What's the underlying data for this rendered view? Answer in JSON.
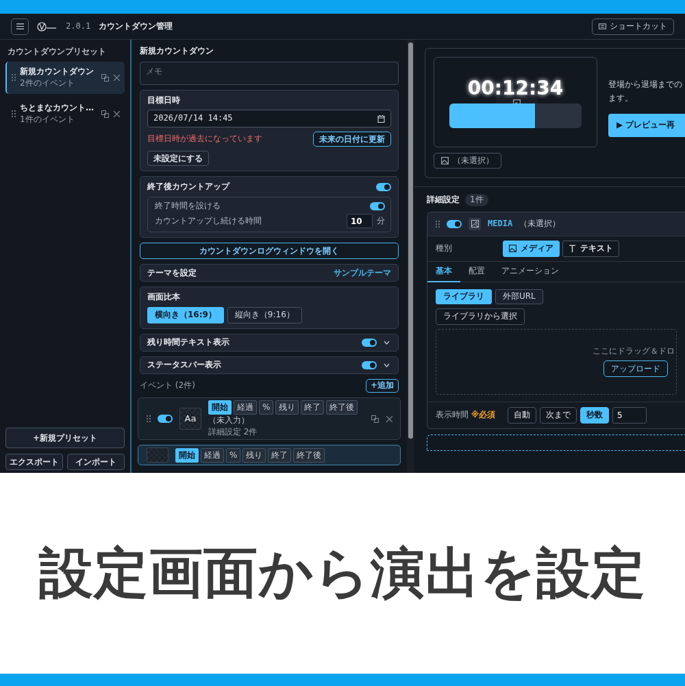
{
  "header": {
    "version": "2.0.1",
    "title": "カウントダウン管理",
    "shortcut_button": "ショートカット"
  },
  "sidebar": {
    "title": "カウントダウンプリセット",
    "presets": [
      {
        "name": "新規カウントダウン",
        "count": "2件のイベント",
        "selected": true
      },
      {
        "name": "ちとまなカウント…",
        "count": "1件のイベント",
        "selected": false
      }
    ],
    "new_preset_button": "+新規プリセット",
    "export_button": "エクスポート",
    "import_button": "インポート"
  },
  "editor": {
    "title": "新規カウントダウン",
    "memo": {
      "placeholder": "メモ"
    },
    "target": {
      "label": "目標日時",
      "value": "2026/07/14 14:45",
      "warning": "目標日時が過去になっています",
      "update_button": "未来の日付に更新",
      "clear_button": "未設定にする"
    },
    "countup": {
      "label": "終了後カウントアップ",
      "on": true,
      "end_time": {
        "label": "終了時間を設ける",
        "on": true
      },
      "duration": {
        "label": "カウントアップし続ける時間",
        "value": "10",
        "unit": "分"
      }
    },
    "log_button": "カウントダウンログウィンドウを開く",
    "theme": {
      "label": "テーマを設定",
      "value": "サンプルテーマ"
    },
    "aspect": {
      "label": "画面比本",
      "options": [
        {
          "label": "横向き（16:9）",
          "selected": true
        },
        {
          "label": "縦向き（9:16）",
          "selected": false
        }
      ]
    },
    "toggles": [
      {
        "label": "残り時間テキスト表示",
        "on": true
      },
      {
        "label": "ステータスバー表示",
        "on": true
      }
    ],
    "events": {
      "label": "イベント (2件)",
      "add_button": "+追加",
      "items": [
        {
          "selected": false,
          "on": true,
          "thumb": "Aa",
          "phases": [
            {
              "label": "開始",
              "selected": true
            },
            {
              "label": "経過",
              "selected": false
            },
            {
              "label": "%",
              "selected": false
            },
            {
              "label": "残り",
              "selected": false
            },
            {
              "label": "終了",
              "selected": false
            },
            {
              "label": "終了後",
              "selected": false
            }
          ],
          "name": "（未入力）",
          "detail": "詳細設定 2件"
        },
        {
          "selected": true,
          "phases": [
            {
              "label": "開始",
              "selected": true
            },
            {
              "label": "経過",
              "selected": false
            },
            {
              "label": "%",
              "selected": false
            },
            {
              "label": "残り",
              "selected": false
            },
            {
              "label": "終了",
              "selected": false
            },
            {
              "label": "終了後",
              "selected": false
            }
          ]
        }
      ]
    }
  },
  "preview": {
    "time": "00:12:34",
    "level": 0.65,
    "media_button": "（未選択）",
    "description": [
      "登場から退場までの",
      "ます。"
    ],
    "play_button": "▶ プレビュー再"
  },
  "details": {
    "title": "詳細設定",
    "count": "1件",
    "card": {
      "on": true,
      "type": "MEDIA",
      "status": "（未選択）",
      "kind_label": "種別",
      "kinds": [
        {
          "kind": "media",
          "label": "メディア",
          "selected": true
        },
        {
          "kind": "text",
          "label": "テキスト",
          "selected": false
        }
      ],
      "tabs": [
        {
          "label": "基本",
          "selected": true
        },
        {
          "label": "配置",
          "selected": false
        },
        {
          "label": "アニメーション",
          "selected": false
        }
      ],
      "sources": [
        {
          "label": "ライブラリ",
          "selected": true
        },
        {
          "label": "外部URL",
          "selected": false
        }
      ],
      "library_button": "ライブラリから選択",
      "drop_text": "ここにドラッグ＆ドロ",
      "upload_button": "アップロード",
      "duration": {
        "label": "表示時間",
        "required": "※必須",
        "options": [
          {
            "label": "自動",
            "selected": false
          },
          {
            "label": "次まで",
            "selected": false
          },
          {
            "label": "秒数",
            "selected": true
          }
        ],
        "value": "5"
      }
    }
  },
  "caption": "設定画面から演出を設定"
}
